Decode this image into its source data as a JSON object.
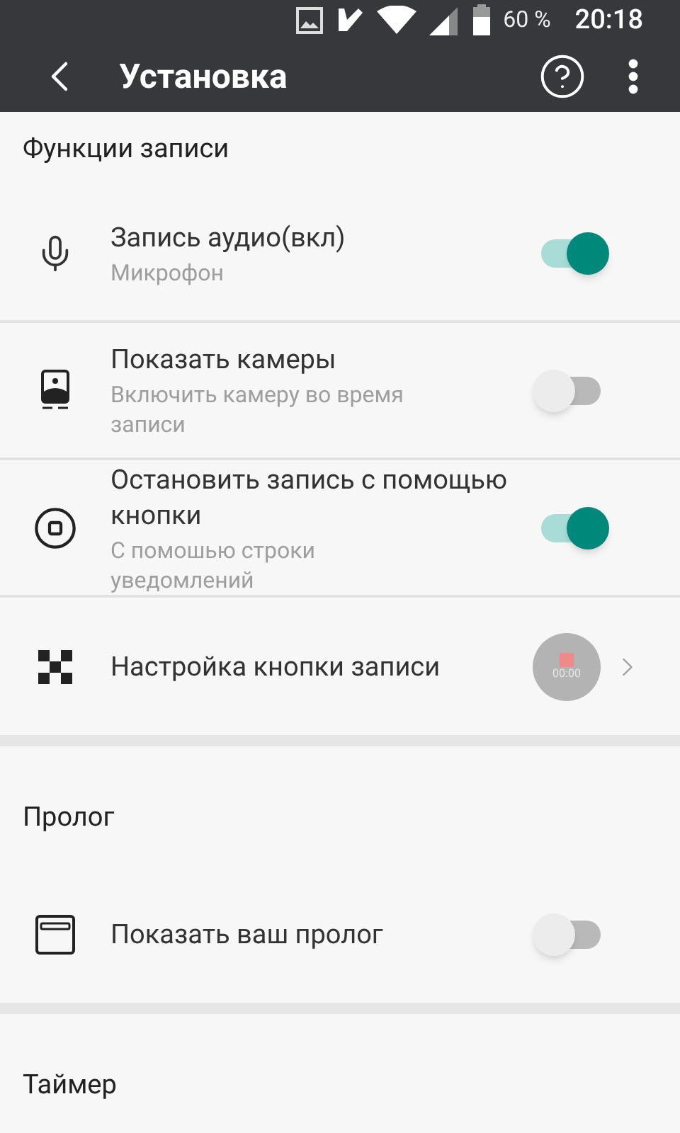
{
  "status_bar": {
    "battery": "60 %",
    "time": "20:18"
  },
  "app_bar": {
    "title": "Установка"
  },
  "sections": [
    {
      "title": "Функции записи",
      "items": [
        {
          "kind": "toggle",
          "title": "Запись аудио(вкл)",
          "subtitle": "Микрофон",
          "on": true
        },
        {
          "kind": "toggle",
          "title": "Показать камеры",
          "subtitle": "Включить камеру во время записи",
          "on": false
        },
        {
          "kind": "toggle",
          "title": "Остановить запись с помощью кнопки",
          "subtitle": "С помошью строки уведомлений",
          "on": true
        },
        {
          "kind": "link",
          "title": "Настройка кнопки записи",
          "preview": "00:00"
        }
      ]
    },
    {
      "title": "Пролог",
      "items": [
        {
          "kind": "toggle",
          "title": "Показать ваш пролог",
          "on": false
        }
      ]
    },
    {
      "title": "Таймер"
    }
  ]
}
